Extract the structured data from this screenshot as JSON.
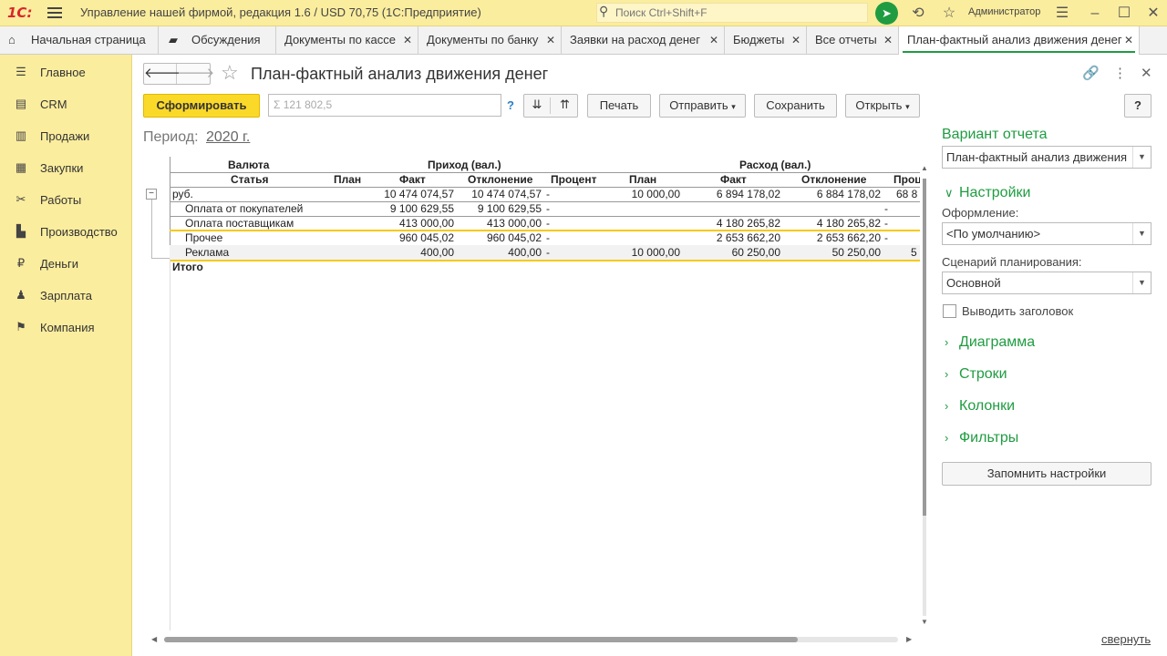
{
  "titlebar": {
    "logo": "1С:",
    "title": "Управление нашей фирмой, редакция 1.6 / USD 70,75  (1С:Предприятие)",
    "search_placeholder": "Поиск Ctrl+Shift+F",
    "user": "Администратор"
  },
  "tabs": [
    {
      "label": "Начальная страница",
      "icon": "home-icon"
    },
    {
      "label": "Обсуждения",
      "icon": "chat-icon"
    },
    {
      "label": "Документы по кассе"
    },
    {
      "label": "Документы по банку"
    },
    {
      "label": "Заявки на расход денег"
    },
    {
      "label": "Бюджеты"
    },
    {
      "label": "Все отчеты"
    },
    {
      "label": "План-фактный анализ движения денег"
    }
  ],
  "sidebar": {
    "items": [
      {
        "label": "Главное",
        "icon": "list-icon"
      },
      {
        "label": "CRM",
        "icon": "contacts-icon"
      },
      {
        "label": "Продажи",
        "icon": "cart-icon"
      },
      {
        "label": "Закупки",
        "icon": "basket-icon"
      },
      {
        "label": "Работы",
        "icon": "tools-icon"
      },
      {
        "label": "Производство",
        "icon": "factory-icon"
      },
      {
        "label": "Деньги",
        "icon": "money-icon"
      },
      {
        "label": "Зарплата",
        "icon": "people-icon"
      },
      {
        "label": "Компания",
        "icon": "flag-icon"
      }
    ]
  },
  "header": {
    "title": "План-фактный анализ движения денег"
  },
  "toolbar": {
    "generate": "Сформировать",
    "sum_placeholder": "Σ 121 802,5",
    "help": "?",
    "print": "Печать",
    "send": "Отправить",
    "save": "Сохранить",
    "open": "Открыть",
    "help_right": "?"
  },
  "period": {
    "label": "Период:",
    "value": "2020 г."
  },
  "report": {
    "group_headers": {
      "currency": "Валюта",
      "income": "Приход (вал.)",
      "expense": "Расход (вал.)"
    },
    "columns": [
      "Статья",
      "План",
      "Факт",
      "Отклонение",
      "Процент",
      "План",
      "Факт",
      "Отклонение",
      "Проц"
    ],
    "rows": [
      {
        "name": "руб.",
        "inc_plan": "",
        "inc_fact": "10 474 074,57",
        "inc_dev": "10 474 074,57",
        "inc_pct": "-",
        "exp_plan": "10 000,00",
        "exp_fact": "6 894 178,02",
        "exp_dev": "6 884 178,02",
        "exp_pct": "68 8"
      },
      {
        "name": "Оплата от покупателей",
        "inc_plan": "",
        "inc_fact": "9 100 629,55",
        "inc_dev": "9 100 629,55",
        "inc_pct": "-",
        "exp_plan": "",
        "exp_fact": "",
        "exp_dev": "",
        "exp_pct": "-"
      },
      {
        "name": "Оплата поставщикам",
        "inc_plan": "",
        "inc_fact": "413 000,00",
        "inc_dev": "413 000,00",
        "inc_pct": "-",
        "exp_plan": "",
        "exp_fact": "4 180 265,82",
        "exp_dev": "4 180 265,82",
        "exp_pct": "-"
      },
      {
        "name": "Прочее",
        "inc_plan": "",
        "inc_fact": "960 045,02",
        "inc_dev": "960 045,02",
        "inc_pct": "-",
        "exp_plan": "",
        "exp_fact": "2 653 662,20",
        "exp_dev": "2 653 662,20",
        "exp_pct": "-"
      },
      {
        "name": "Реклама",
        "inc_plan": "",
        "inc_fact": "400,00",
        "inc_dev": "400,00",
        "inc_pct": "-",
        "exp_plan": "10 000,00",
        "exp_fact": "60 250,00",
        "exp_dev": "50 250,00",
        "exp_pct": "5"
      }
    ],
    "total": "Итого"
  },
  "panel": {
    "variant_title": "Вариант отчета",
    "variant_value": "План-фактный анализ движения де",
    "settings_title": "Настройки",
    "format_label": "Оформление:",
    "format_value": "<По умолчанию>",
    "scenario_label": "Сценарий планирования:",
    "scenario_value": "Основной",
    "show_header_label": "Выводить заголовок",
    "show_header_checked": false,
    "sections": [
      "Диаграмма",
      "Строки",
      "Колонки",
      "Фильтры"
    ],
    "remember": "Запомнить настройки",
    "collapse": "свернуть"
  },
  "colors": {
    "accent_green": "#1f9c41",
    "sidebar_bg": "#fbed9e",
    "primary_button": "#fbd928",
    "highlight_line": "#f6c90e"
  }
}
